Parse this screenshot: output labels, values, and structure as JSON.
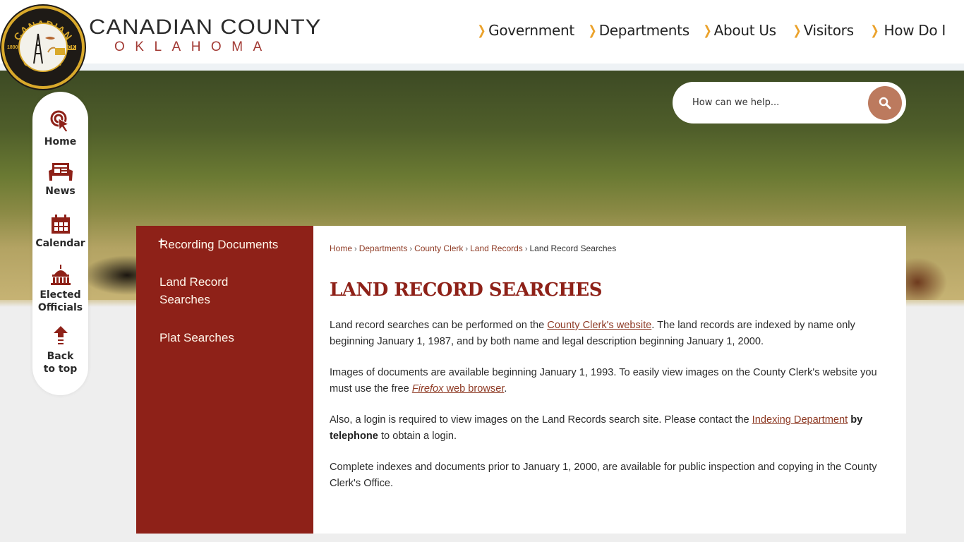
{
  "brand": {
    "seal": {
      "top_text": "CANADIAN",
      "bottom_text": "COUNTY",
      "year": "1890",
      "state_abbr": "OK"
    },
    "title": "CANADIAN COUNTY",
    "subtitle": "OKLAHOMA"
  },
  "colors": {
    "accent": "#8e2118",
    "chevron": "#eba22b",
    "search_button": "#bc7a5e",
    "link": "#8e3a24"
  },
  "topnav": {
    "items": [
      {
        "label": "Government",
        "icon": "chevron-right-icon"
      },
      {
        "label": "Departments",
        "icon": "chevron-right-icon"
      },
      {
        "label": "About Us",
        "icon": "chevron-right-icon"
      },
      {
        "label": "Visitors",
        "icon": "chevron-right-icon"
      },
      {
        "label": "How Do I",
        "icon": "chevron-right-icon"
      }
    ]
  },
  "search": {
    "placeholder": "How can we help...",
    "value": "",
    "button_icon": "search-icon"
  },
  "quicklinks": {
    "items": [
      {
        "label": "Home",
        "icon": "pointer-click-icon"
      },
      {
        "label": "News",
        "icon": "newspaper-icon"
      },
      {
        "label": "Calendar",
        "icon": "calendar-icon"
      },
      {
        "label_line1": "Elected",
        "label_line2": "Officials",
        "icon": "capitol-building-icon"
      },
      {
        "label_line1": "Back",
        "label_line2": "to top",
        "icon": "arrow-up-icon"
      }
    ]
  },
  "subnav": {
    "items": [
      {
        "label": "Recording Documents",
        "expand_icon": "plus-icon",
        "expand_symbol": "+"
      },
      {
        "label": "Land Record Searches"
      },
      {
        "label": "Plat Searches"
      }
    ]
  },
  "breadcrumb": {
    "separator": "›",
    "items": [
      {
        "label": "Home"
      },
      {
        "label": "Departments"
      },
      {
        "label": "County Clerk"
      },
      {
        "label": "Land Records"
      }
    ],
    "current": "Land Record Searches"
  },
  "page": {
    "title": "LAND RECORD SEARCHES",
    "paragraphs": {
      "p1": {
        "before": "Land record searches can be performed on the ",
        "link": "County Clerk's website",
        "after": ". The land records are indexed by name only beginning January 1, 1987, and by both name and legal description beginning January 1, 2000."
      },
      "p2": {
        "before": "Images of documents are available beginning January 1, 1993. To easily view images on the County Clerk's website you must use the free ",
        "link_italic": "Firefox",
        "link_rest": " web browser",
        "after": "."
      },
      "p3": {
        "before": "Also, a login is required to view images on the Land Records search site. Please contact the ",
        "link": "Indexing Department",
        "bold": " by telephone",
        "after": " to obtain a login."
      },
      "p4": {
        "text": "Complete indexes and documents prior to January 1, 2000, are available for public inspection and copying in the County Clerk's Office."
      }
    }
  }
}
